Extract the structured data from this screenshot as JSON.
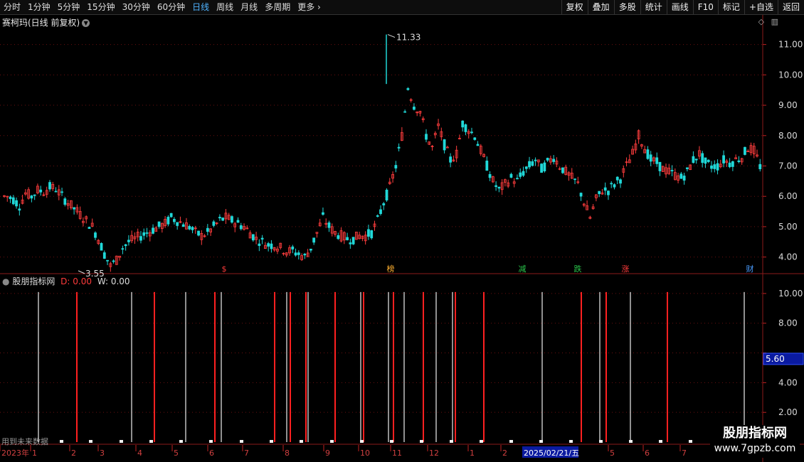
{
  "toolbar": {
    "periods": [
      "分时",
      "1分钟",
      "5分钟",
      "15分钟",
      "30分钟",
      "60分钟",
      "日线",
      "周线",
      "月线",
      "多周期",
      "更多"
    ],
    "active_period": "日线",
    "buttons": [
      "复权",
      "叠加",
      "多股",
      "统计",
      "画线",
      "F10",
      "标记",
      "+自选",
      "返回"
    ]
  },
  "main_chart": {
    "title": "赛柯玛(日线 前复权)",
    "high_label": "11.33",
    "low_label": "3.55",
    "y_ticks": [
      "11.00",
      "10.00",
      "9.00",
      "8.00",
      "7.00",
      "6.00",
      "5.00",
      "4.00"
    ],
    "markers": [
      {
        "text": "$",
        "color": "#ff3b3b"
      },
      {
        "text": "榜",
        "color": "#ffb030"
      },
      {
        "text": "减",
        "color": "#29c44a"
      },
      {
        "text": "跌",
        "color": "#29c44a"
      },
      {
        "text": "涨",
        "color": "#ff3b3b"
      },
      {
        "text": "财",
        "color": "#4a9cff"
      }
    ]
  },
  "indicator": {
    "name": "股朋指标网",
    "d_label": "D: 0.00",
    "w_label": "W: 0.00",
    "y_ticks": [
      "10.00",
      "8.00",
      "4.00",
      "2.00"
    ],
    "current_value": "5.60"
  },
  "x_axis": {
    "labels": [
      "2023年",
      "1",
      "2",
      "3",
      "4",
      "5",
      "6",
      "7",
      "8",
      "9",
      "10",
      "11",
      "12",
      "1",
      "2",
      "5",
      "6",
      "7"
    ],
    "cursor_date": "2025/02/21/五"
  },
  "future_note": "用到未来数据",
  "watermark": {
    "line1": "股朋指标网",
    "line2": "www.7gpzb.com"
  },
  "chart_data": {
    "type": "candlestick",
    "price_axis_range": [
      3.5,
      11.6
    ],
    "high": 11.33,
    "low": 3.55,
    "close_path": [
      6.0,
      5.9,
      5.7,
      6.1,
      6.0,
      6.2,
      6.15,
      6.3,
      6.25,
      6.0,
      5.8,
      5.6,
      5.4,
      5.2,
      5.0,
      4.6,
      4.1,
      3.7,
      3.9,
      4.3,
      4.5,
      4.6,
      4.7,
      4.8,
      4.9,
      5.0,
      5.1,
      5.3,
      5.2,
      5.1,
      5.0,
      4.8,
      4.7,
      4.8,
      5.0,
      5.2,
      5.3,
      5.2,
      5.1,
      5.0,
      4.8,
      4.6,
      4.5,
      4.4,
      4.4,
      4.3,
      4.2,
      4.2,
      4.1,
      4.0,
      4.3,
      4.8,
      5.3,
      5.0,
      4.8,
      4.7,
      4.6,
      4.6,
      4.7,
      4.7,
      4.8,
      5.2,
      5.8,
      6.3,
      7.0,
      8.0,
      9.6,
      9.0,
      8.8,
      8.0,
      7.6,
      8.3,
      7.7,
      7.2,
      7.4,
      8.4,
      8.2,
      8.0,
      7.5,
      7.0,
      6.5,
      6.2,
      6.4,
      6.6,
      6.5,
      6.8,
      7.0,
      7.2,
      6.9,
      7.1,
      7.3,
      7.0,
      6.8,
      6.6,
      6.4,
      5.8,
      5.3,
      5.9,
      6.2,
      6.2,
      6.4,
      6.6,
      7.0,
      7.4,
      8.0,
      7.6,
      7.2,
      7.1,
      6.9,
      6.8,
      6.7,
      6.6,
      6.8,
      7.2,
      7.4,
      7.1,
      7.0,
      7.0,
      7.2,
      7.1,
      7.2,
      7.3,
      7.6,
      7.5,
      7.0
    ]
  }
}
